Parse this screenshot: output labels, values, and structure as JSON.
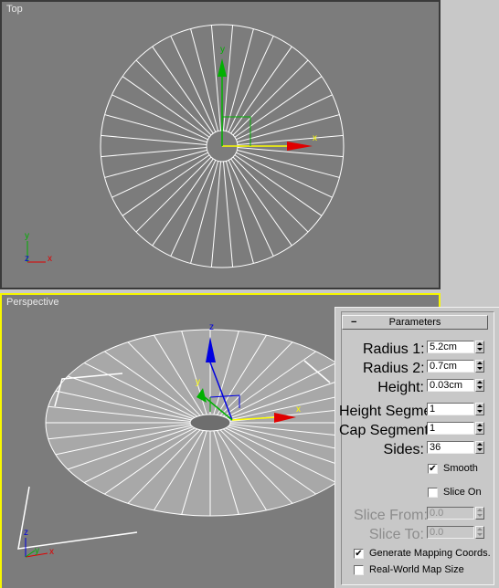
{
  "viewports": {
    "top_label": "Top",
    "perspective_label": "Perspective"
  },
  "axes": {
    "x": "x",
    "y": "y",
    "z": "z"
  },
  "colors": {
    "viewport_bg": "#7c7c7c",
    "active_border": "#f7f700",
    "wire": "#ffffff",
    "axis_x": "#e00000",
    "axis_y": "#00b000",
    "axis_z": "#0000e0",
    "gizmo_axis": "#ffff00"
  },
  "parameters": {
    "rollout_title": "Parameters",
    "collapse_symbol": "−",
    "radius1_label": "Radius 1:",
    "radius1_value": "5.2cm",
    "radius2_label": "Radius 2:",
    "radius2_value": "0.7cm",
    "height_label": "Height:",
    "height_value": "0.03cm",
    "height_segments_label": "Height Segments:",
    "height_segments_value": "1",
    "cap_segments_label": "Cap Segments:",
    "cap_segments_value": "1",
    "sides_label": "Sides:",
    "sides_value": "36",
    "smooth_label": "Smooth",
    "smooth_checked": true,
    "slice_on_label": "Slice On",
    "slice_on_checked": false,
    "slice_from_label": "Slice From:",
    "slice_from_value": "0.0",
    "slice_to_label": "Slice To:",
    "slice_to_value": "0.0",
    "gen_mapping_label": "Generate Mapping Coords.",
    "gen_mapping_checked": true,
    "real_world_label": "Real-World Map Size",
    "real_world_checked": false
  }
}
